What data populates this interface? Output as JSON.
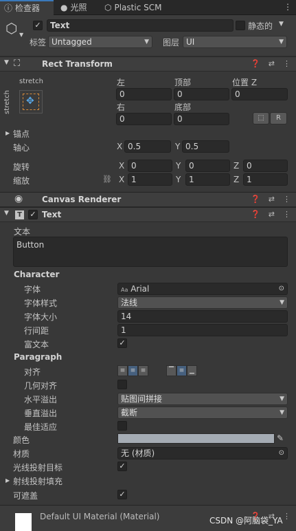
{
  "tabs": [
    {
      "label": "检查器",
      "icon": "info-icon"
    },
    {
      "label": "光照",
      "icon": "bulb-icon"
    },
    {
      "label": "Plastic SCM",
      "icon": "plastic-icon"
    }
  ],
  "object": {
    "name": "Text",
    "static_label": "静态的",
    "tag_label": "标签",
    "tag_value": "Untagged",
    "layer_label": "图层",
    "layer_value": "UI"
  },
  "rect": {
    "title": "Rect Transform",
    "anchor_preset_top": "stretch",
    "anchor_preset_side": "stretch",
    "left_label": "左",
    "left": "0",
    "top_label": "顶部",
    "top": "0",
    "posz_label": "位置 Z",
    "posz": "0",
    "right_label": "右",
    "right": "0",
    "bottom_label": "底部",
    "bottom": "0",
    "r_button": "R",
    "anchors_label": "锚点",
    "pivot_label": "轴心",
    "pivot_x": "0.5",
    "pivot_y": "0.5",
    "rotation_label": "旋转",
    "rot_x": "0",
    "rot_y": "0",
    "rot_z": "0",
    "scale_label": "缩放",
    "scale_x": "1",
    "scale_y": "1",
    "scale_z": "1",
    "x": "X",
    "y": "Y",
    "z": "Z"
  },
  "canvas_renderer": {
    "title": "Canvas Renderer"
  },
  "text_comp": {
    "title": "Text",
    "text_label": "文本",
    "text_value": "Button",
    "character_label": "Character",
    "font_label": "字体",
    "font_value": "Arial",
    "font_prefix": "Aa",
    "style_label": "字体样式",
    "style_value": "法线",
    "size_label": "字体大小",
    "size_value": "14",
    "linespacing_label": "行间距",
    "linespacing_value": "1",
    "richtext_label": "富文本",
    "paragraph_label": "Paragraph",
    "align_label": "对齐",
    "geo_align_label": "几何对齐",
    "hoverflow_label": "水平溢出",
    "hoverflow_value": "贴图间拼接",
    "voverflow_label": "垂直溢出",
    "voverflow_value": "截断",
    "bestfit_label": "最佳适应",
    "color_label": "颜色",
    "color_value": "#a5acb4",
    "material_label": "材质",
    "material_value": "无 (材质)",
    "raycast_label": "光线投射目标",
    "raycast_padding_label": "射线投射填充",
    "maskable_label": "可遮盖"
  },
  "footer": {
    "material_name": "Default UI Material (Material)",
    "watermark": "CSDN @阿脑袋_YA"
  }
}
